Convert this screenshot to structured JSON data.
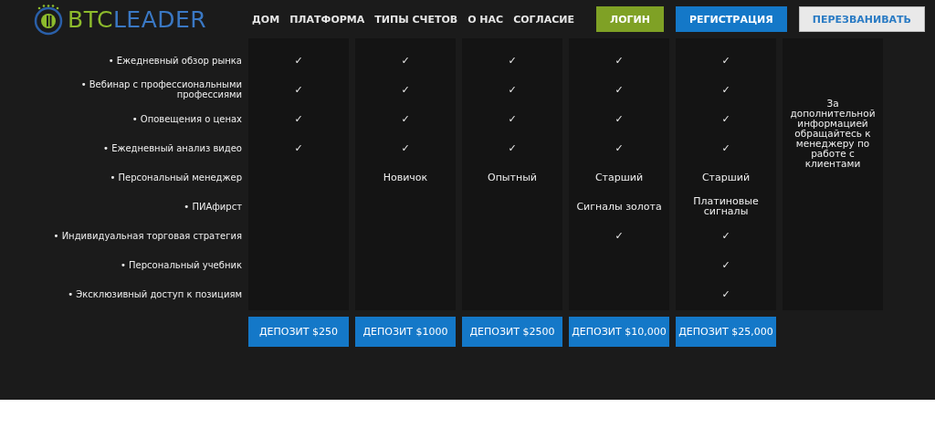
{
  "header": {
    "logo": [
      {
        "text": "BTC",
        "color": "#8dbb2c"
      },
      {
        "text": "LEADER",
        "color": "#3a78c4"
      }
    ],
    "nav": [
      "ДОМ",
      "ПЛАТФОРМА",
      "ТИПЫ СЧЕТОВ",
      "О НАС",
      "СОГЛАСИЕ"
    ],
    "buttons": [
      {
        "label": "ЛОГИН",
        "kind": "green"
      },
      {
        "label": "РЕГИСТРАЦИЯ",
        "kind": "blue"
      },
      {
        "label": "ПЕРЕЗВАНИВАТЬ",
        "kind": "light"
      }
    ]
  },
  "features": [
    "• Ежедневный обзор рынка",
    "• Вебинар с профессиональными профессиями",
    "• Оповещения о ценах",
    "• Ежедневный анализ видео",
    "• Персональный менеджер",
    "• ПИАфирст",
    "• Индивидуальная торговая стратегия",
    "• Персональный учебник",
    "• Эксклюзивный доступ к позициям"
  ],
  "plans": [
    {
      "cells": [
        "✓",
        "✓",
        "✓",
        "✓",
        null,
        null,
        null,
        null,
        null
      ],
      "deposit": "ДЕПОЗИТ $250"
    },
    {
      "cells": [
        "✓",
        "✓",
        "✓",
        "✓",
        "Новичок",
        null,
        null,
        null,
        null
      ],
      "deposit": "ДЕПОЗИТ $1000"
    },
    {
      "cells": [
        "✓",
        "✓",
        "✓",
        "✓",
        "Опытный",
        null,
        null,
        null,
        null
      ],
      "deposit": "ДЕПОЗИТ $2500"
    },
    {
      "cells": [
        "✓",
        "✓",
        "✓",
        "✓",
        "Старший",
        "Сигналы золота",
        "✓",
        null,
        null
      ],
      "deposit": "ДЕПОЗИТ $10,000"
    },
    {
      "cells": [
        "✓",
        "✓",
        "✓",
        "✓",
        "Старший",
        "Платиновые сигналы",
        "✓",
        "✓",
        "✓"
      ],
      "deposit": "ДЕПОЗИТ $25,000"
    }
  ],
  "note": "За дополнительной информацией обращайтесь к менеджеру по работе с клиентами"
}
